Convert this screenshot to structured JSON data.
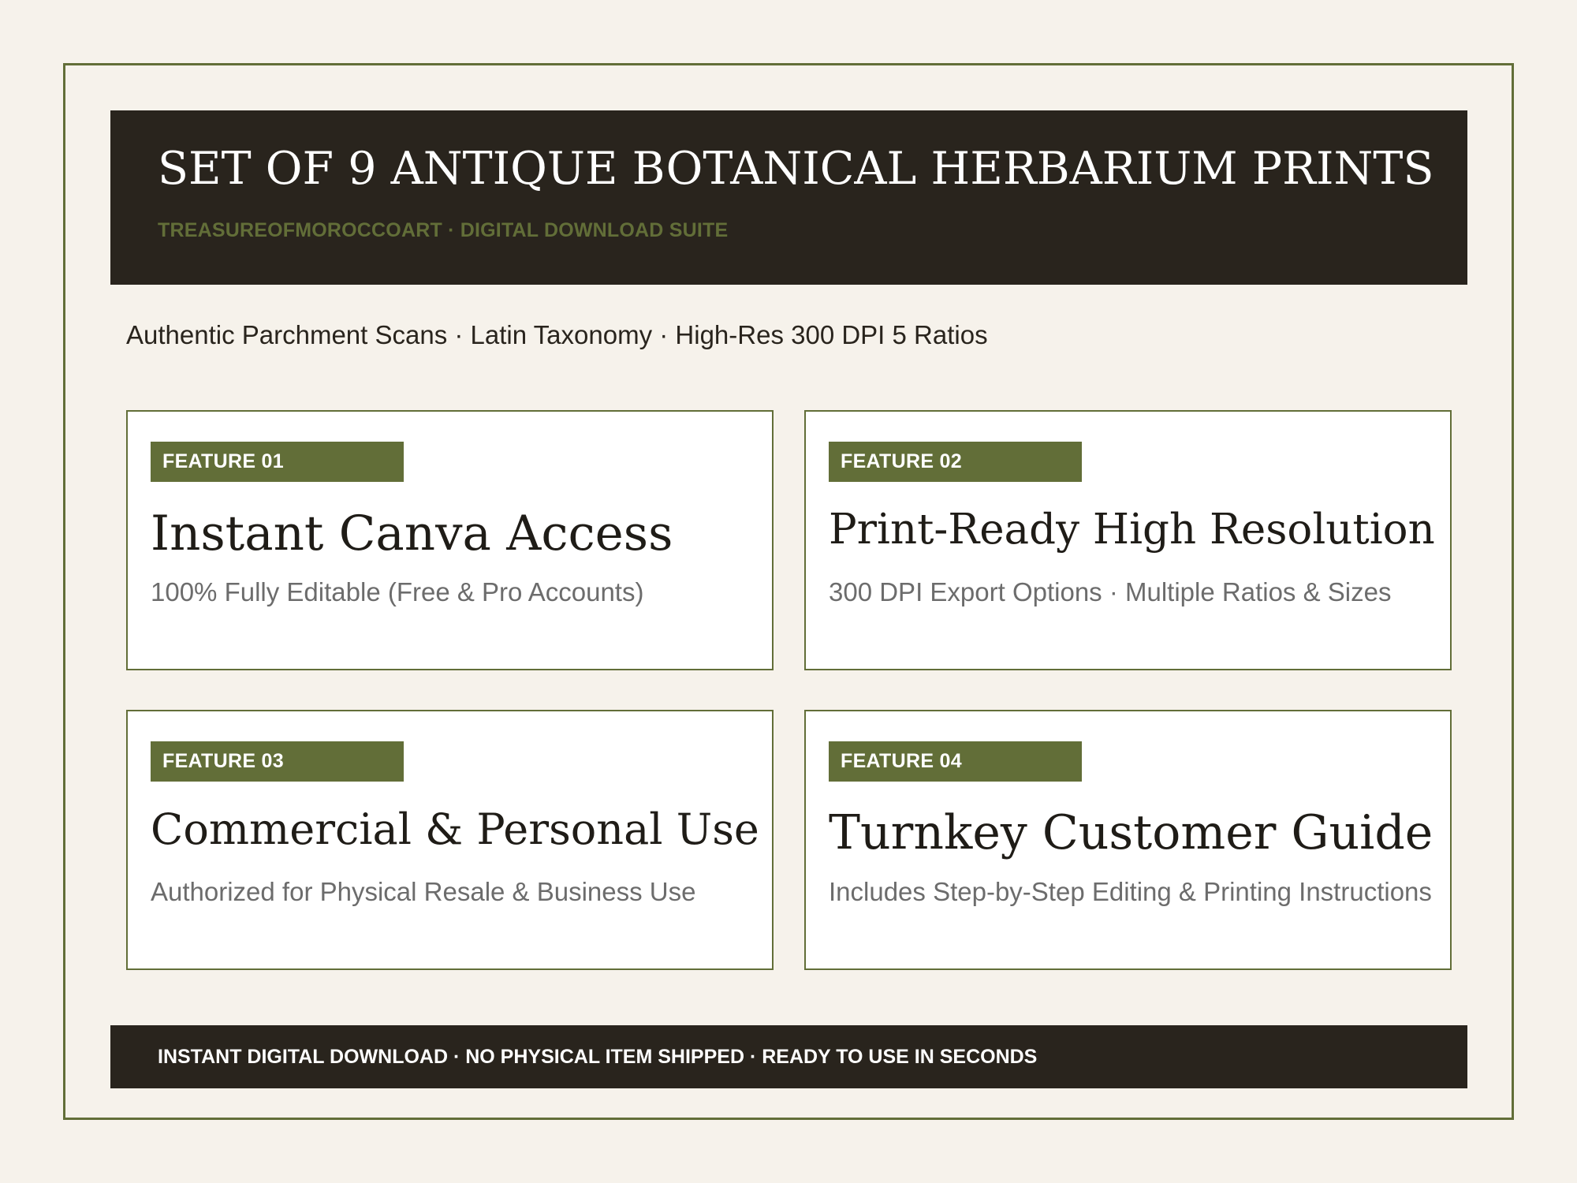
{
  "header": {
    "title": "SET OF 9 ANTIQUE BOTANICAL HERBARIUM PRINTS",
    "subtitle": "TREASUREOFMOROCCOART · DIGITAL DOWNLOAD SUITE"
  },
  "tagline": "Authentic Parchment Scans · Latin Taxonomy · High-Res 300 DPI 5 Ratios",
  "features": [
    {
      "badge": "FEATURE 01",
      "title": "Instant Canva Access",
      "description": "100% Fully Editable (Free & Pro Accounts)"
    },
    {
      "badge": "FEATURE 02",
      "title": "Print-Ready High Resolution",
      "description": "300 DPI Export Options · Multiple Ratios & Sizes"
    },
    {
      "badge": "FEATURE 03",
      "title": "Commercial & Personal Use",
      "description": "Authorized for Physical Resale & Business Use"
    },
    {
      "badge": "FEATURE 04",
      "title": "Turnkey Customer Guide",
      "description": "Includes Step-by-Step Editing & Printing Instructions"
    }
  ],
  "footer": {
    "text": "INSTANT DIGITAL DOWNLOAD · NO PHYSICAL ITEM SHIPPED · READY TO USE IN SECONDS"
  },
  "colors": {
    "background": "#f6f2eb",
    "dark": "#29241d",
    "accent": "#626e38",
    "muted_text": "#6c6c6c"
  }
}
